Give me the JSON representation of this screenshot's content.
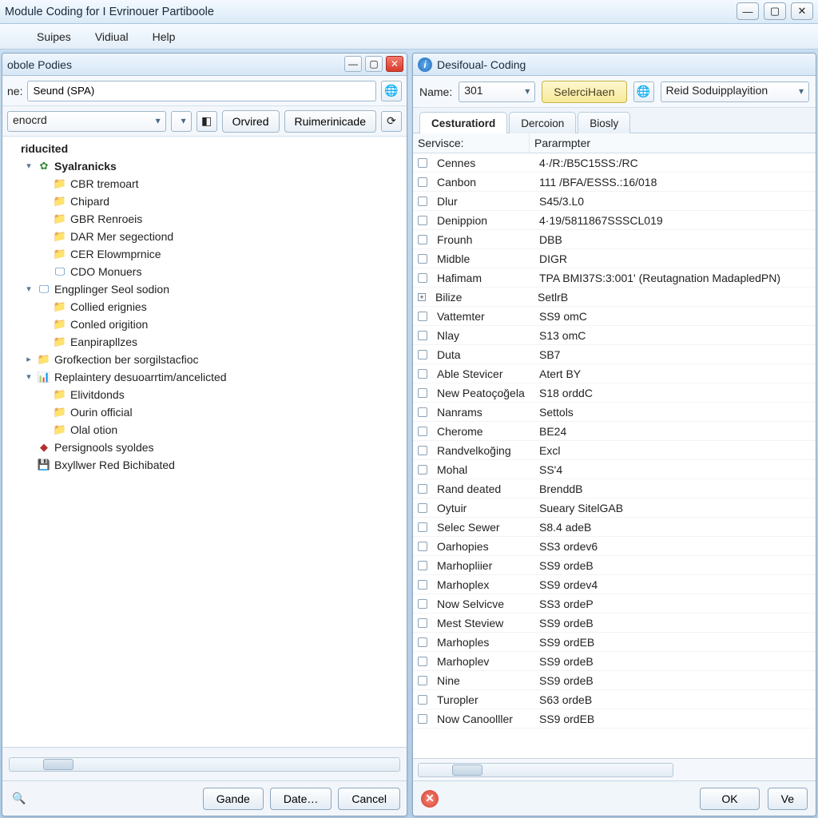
{
  "window": {
    "title": "Module Coding for I Evrinouer Partiboole"
  },
  "menus": [
    "",
    "Suipes",
    "Vidiual",
    "Help"
  ],
  "left_panel": {
    "title": "obole Podies",
    "label_name": "ne:",
    "name_value": "Seund (SPA)",
    "filter_value": "enocrd",
    "btn_orvired": "Orvired",
    "btn_rumer": "Ruimerinicade",
    "tree": {
      "root": "riducited",
      "n0": "Syalranicks",
      "n0_children": [
        "CBR tremoart",
        "Chipard",
        "GBR Renroeis",
        "DAR Mer segectiond",
        "CER Elowmprnice",
        "CDO Monuers"
      ],
      "n1": "Engplinger Seol sodion",
      "n1_children": [
        "Collied erignies",
        "Conled origition",
        "Eanpirapllzes"
      ],
      "n2": "Grofkection ber sorgilstacfioc",
      "n3": "Replaintery desuoarrtim/ancelicted",
      "n3_children": [
        "Elivitdonds",
        "Ourin official",
        "Olal otion"
      ],
      "n4": "Persignools syoldes",
      "n5": "Bxyllwer Red Bichibated"
    },
    "footer": {
      "btn_gande": "Gande",
      "btn_date": "Date…",
      "btn_cancel": "Cancel"
    }
  },
  "right_panel": {
    "title": "Desifoual- Coding",
    "label_name": "Name:",
    "name_value": "301",
    "btn_select": "SelerciHaen",
    "combo_right": "Reid Soduipplayition",
    "tabs": [
      "Cesturatiord",
      "Dercoion",
      "Biosly"
    ],
    "grid_header": {
      "svc": "Servisce:",
      "prm": "Pararmpter"
    },
    "rows": [
      {
        "svc": "Cennes",
        "prm": "4·/R:/B5C15SS:/RC"
      },
      {
        "svc": "Canbon",
        "prm": "111 /BFA/ESSS.:16/018"
      },
      {
        "svc": "Dlur",
        "prm": "S45/3.L0"
      },
      {
        "svc": "Denippion",
        "prm": "4·19/5811867SSSCL019"
      },
      {
        "svc": "Frounh",
        "prm": "DBB"
      },
      {
        "svc": "Midble",
        "prm": "DIGR"
      },
      {
        "svc": "Hafimam",
        "prm": "TPA BMI37S:3:001' (Reutagnation MadapledPN)"
      },
      {
        "svc": "Bilize",
        "prm": "SetlrB",
        "exp": true
      },
      {
        "svc": "Vattemter",
        "prm": "SS9 omC"
      },
      {
        "svc": "Nlay",
        "prm": "S13 omC"
      },
      {
        "svc": "Duta",
        "prm": "SB7"
      },
      {
        "svc": "Able Stevicer",
        "prm": "Atert BY"
      },
      {
        "svc": "New Peatoçoğela",
        "prm": "S18 orddC"
      },
      {
        "svc": "Nanrams",
        "prm": "Settols"
      },
      {
        "svc": "Cherome",
        "prm": "BE24"
      },
      {
        "svc": "Randvelkoğing",
        "prm": "Excl"
      },
      {
        "svc": "Mohal",
        "prm": "SS'4"
      },
      {
        "svc": "Rand deated",
        "prm": "BrenddB"
      },
      {
        "svc": "Oytuir",
        "prm": "Sueary SitelGAB"
      },
      {
        "svc": "Selec Sewer",
        "prm": "S8.4 adeB"
      },
      {
        "svc": "Oarhopies",
        "prm": "SS3 ordev6"
      },
      {
        "svc": "Marhopliier",
        "prm": "SS9 ordeB"
      },
      {
        "svc": "Marhoplex",
        "prm": "SS9 ordev4"
      },
      {
        "svc": "Now Selvicve",
        "prm": "SS3 ordeP"
      },
      {
        "svc": "Mest Steview",
        "prm": "SS9 ordeB"
      },
      {
        "svc": "Marhoples",
        "prm": "SS9 ordEB"
      },
      {
        "svc": "Marhoplev",
        "prm": "SS9 ordeB"
      },
      {
        "svc": "Nine",
        "prm": "SS9 ordeB"
      },
      {
        "svc": "Turopler",
        "prm": "S63 ordeB"
      },
      {
        "svc": "Now Canoolller",
        "prm": "SS9 ordEB"
      }
    ],
    "footer": {
      "btn_ok": "OK",
      "btn_ve": "Ve"
    }
  }
}
